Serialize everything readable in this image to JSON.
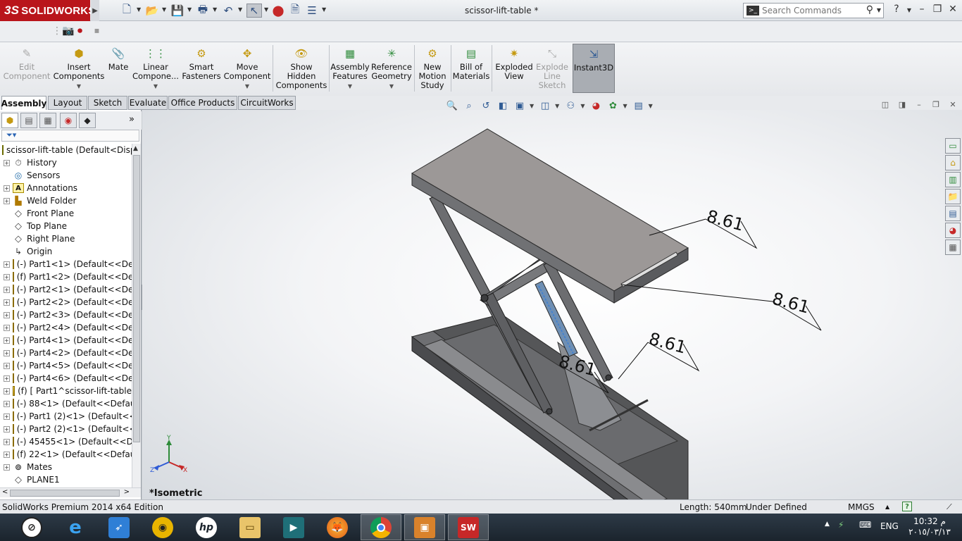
{
  "app": {
    "brand": "SOLIDWORKS",
    "brand_prefix": "3S",
    "document_title": "scissor-lift-table *",
    "search_placeholder": "Search Commands",
    "help_label": "?",
    "accent": "#b9151b"
  },
  "command_manager": [
    {
      "label": "Edit\nComponent",
      "icon": "edit-component-icon",
      "enabled": false
    },
    {
      "label": "Insert\nComponents",
      "icon": "insert-components-icon",
      "enabled": true
    },
    {
      "label": "Mate",
      "icon": "mate-icon",
      "enabled": true
    },
    {
      "label": "Linear\nCompone...",
      "icon": "linear-pattern-icon",
      "enabled": true
    },
    {
      "label": "Smart\nFasteners",
      "icon": "smart-fasteners-icon",
      "enabled": true
    },
    {
      "label": "Move\nComponent",
      "icon": "move-component-icon",
      "enabled": true
    },
    {
      "label": "Show\nHidden\nComponents",
      "icon": "show-hidden-icon",
      "enabled": true
    },
    {
      "label": "Assembly\nFeatures",
      "icon": "assembly-features-icon",
      "enabled": true
    },
    {
      "label": "Reference\nGeometry",
      "icon": "reference-geometry-icon",
      "enabled": true
    },
    {
      "label": "New\nMotion\nStudy",
      "icon": "motion-study-icon",
      "enabled": true
    },
    {
      "label": "Bill of\nMaterials",
      "icon": "bom-icon",
      "enabled": true
    },
    {
      "label": "Exploded\nView",
      "icon": "exploded-view-icon",
      "enabled": true
    },
    {
      "label": "Explode\nLine\nSketch",
      "icon": "explode-line-icon",
      "enabled": false
    },
    {
      "label": "Instant3D",
      "icon": "instant3d-icon",
      "enabled": true,
      "active": true
    }
  ],
  "tabs": [
    "Assembly",
    "Layout",
    "Sketch",
    "Evaluate",
    "Office Products",
    "CircuitWorks"
  ],
  "active_tab": "Assembly",
  "feature_tree": {
    "root": "scissor-lift-table  (Default<Disp",
    "items": [
      {
        "label": "History",
        "icon": "history-icon",
        "expandable": true
      },
      {
        "label": "Sensors",
        "icon": "sensors-icon",
        "expandable": false
      },
      {
        "label": "Annotations",
        "icon": "annotations-icon",
        "expandable": true
      },
      {
        "label": "Weld Folder",
        "icon": "weld-folder-icon",
        "expandable": true
      },
      {
        "label": "Front Plane",
        "icon": "plane-icon",
        "expandable": false
      },
      {
        "label": "Top Plane",
        "icon": "plane-icon",
        "expandable": false
      },
      {
        "label": "Right Plane",
        "icon": "plane-icon",
        "expandable": false
      },
      {
        "label": "Origin",
        "icon": "origin-icon",
        "expandable": false
      },
      {
        "label": "(-) Part1<1> (Default<<Def",
        "icon": "part-icon",
        "expandable": true
      },
      {
        "label": "(f) Part1<2> (Default<<Def",
        "icon": "part-icon",
        "expandable": true
      },
      {
        "label": "(-) Part2<1> (Default<<Def",
        "icon": "part-icon",
        "expandable": true
      },
      {
        "label": "(-) Part2<2> (Default<<Def",
        "icon": "part-icon",
        "expandable": true
      },
      {
        "label": "(-) Part2<3> (Default<<Def",
        "icon": "part-icon",
        "expandable": true
      },
      {
        "label": "(-) Part2<4> (Default<<Def",
        "icon": "part-icon",
        "expandable": true
      },
      {
        "label": "(-) Part4<1> (Default<<Def",
        "icon": "part-icon",
        "expandable": true
      },
      {
        "label": "(-) Part4<2> (Default<<Def",
        "icon": "part-icon",
        "expandable": true
      },
      {
        "label": "(-) Part4<5> (Default<<Def",
        "icon": "part-icon",
        "expandable": true
      },
      {
        "label": "(-) Part4<6> (Default<<Def",
        "icon": "part-icon",
        "expandable": true
      },
      {
        "label": "(f) [ Part1^scissor-lift-table",
        "icon": "part-icon",
        "expandable": true
      },
      {
        "label": "(-) 88<1> (Default<<Defau",
        "icon": "part-icon",
        "expandable": true
      },
      {
        "label": "(-) Part1 (2)<1> (Default<<",
        "icon": "part-icon",
        "expandable": true
      },
      {
        "label": "(-) Part2 (2)<1> (Default<<",
        "icon": "part-icon",
        "expandable": true
      },
      {
        "label": "(-) 45455<1> (Default<<De",
        "icon": "part-icon",
        "expandable": true
      },
      {
        "label": "(f) 22<1> (Default<<Defaul",
        "icon": "part-icon",
        "expandable": true
      },
      {
        "label": "Mates",
        "icon": "mates-icon",
        "expandable": true
      },
      {
        "label": "PLANE1",
        "icon": "plane-icon",
        "expandable": false
      }
    ]
  },
  "viewport": {
    "view_label": "*Isometric",
    "annotations": [
      "8.61",
      "8.61",
      "8.61",
      "8.61"
    ],
    "triad": {
      "x": "X",
      "y": "Y",
      "z": "Z"
    }
  },
  "status": {
    "edition": "SolidWorks Premium 2014 x64 Edition",
    "length": "Length: 540mm",
    "state": "Under Defined",
    "units": "MMGS",
    "units_arrow": "▲",
    "help": "?"
  },
  "taskbar": {
    "apps": [
      "hp-icon",
      "internet-explorer-icon",
      "rocket-icon",
      "media-icon",
      "hp-logo-icon",
      "file-explorer-icon",
      "video-icon",
      "firefox-icon",
      "chrome-icon",
      "package-icon",
      "solidworks-icon"
    ],
    "language": "ENG",
    "time": "10:32 م",
    "date": "٢٠١٥/٠٣/١٣"
  }
}
